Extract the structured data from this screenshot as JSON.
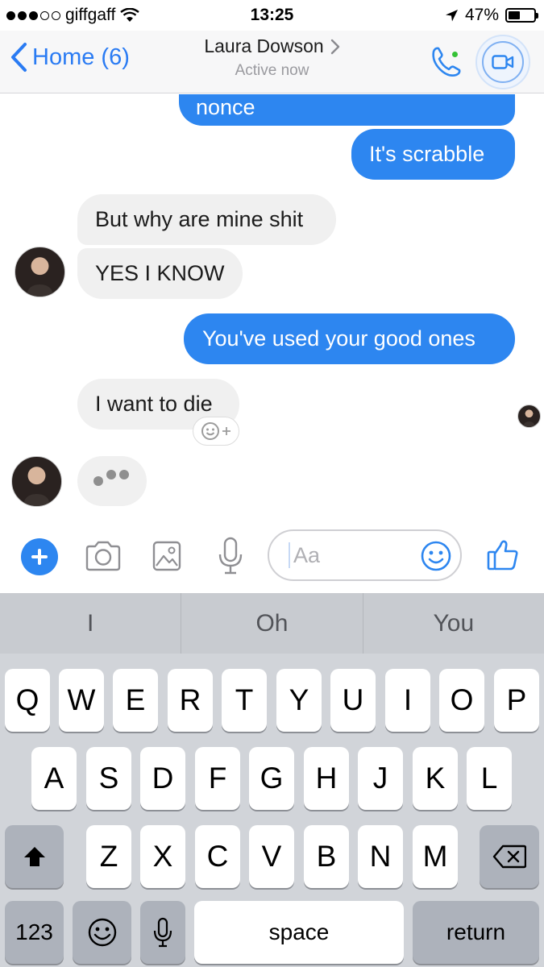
{
  "status_bar": {
    "carrier": "giffgaff",
    "time": "13:25",
    "battery_percent": "47%",
    "battery_level": 0.47,
    "icons": [
      "signal-dots-icon",
      "wifi-icon",
      "location-arrow-icon",
      "battery-icon"
    ]
  },
  "header": {
    "back_label": "Home (6)",
    "contact_name": "Laura Dowson",
    "status": "Active now",
    "call_status_color": "#35c236"
  },
  "messages": [
    {
      "text": "nonce",
      "direction": "outgoing"
    },
    {
      "text": "It's scrabble",
      "direction": "outgoing"
    },
    {
      "text": "But why are mine shit",
      "direction": "incoming"
    },
    {
      "text": "YES I KNOW",
      "direction": "incoming"
    },
    {
      "text": "You've used your good ones",
      "direction": "outgoing"
    },
    {
      "text": "I want to die",
      "direction": "incoming"
    }
  ],
  "typing_indicator": true,
  "composer": {
    "placeholder": "Aa"
  },
  "keyboard": {
    "predictions": [
      "I",
      "Oh",
      "You"
    ],
    "row1": [
      "Q",
      "W",
      "E",
      "R",
      "T",
      "Y",
      "U",
      "I",
      "O",
      "P"
    ],
    "row2": [
      "A",
      "S",
      "D",
      "F",
      "G",
      "H",
      "J",
      "K",
      "L"
    ],
    "row3": [
      "Z",
      "X",
      "C",
      "V",
      "B",
      "N",
      "M"
    ],
    "numbers_label": "123",
    "space_label": "space",
    "return_label": "return"
  },
  "colors": {
    "accent": "#2d86f0",
    "incoming_bubble": "#f0f0f0",
    "keyboard_bg": "#d1d4d9"
  }
}
